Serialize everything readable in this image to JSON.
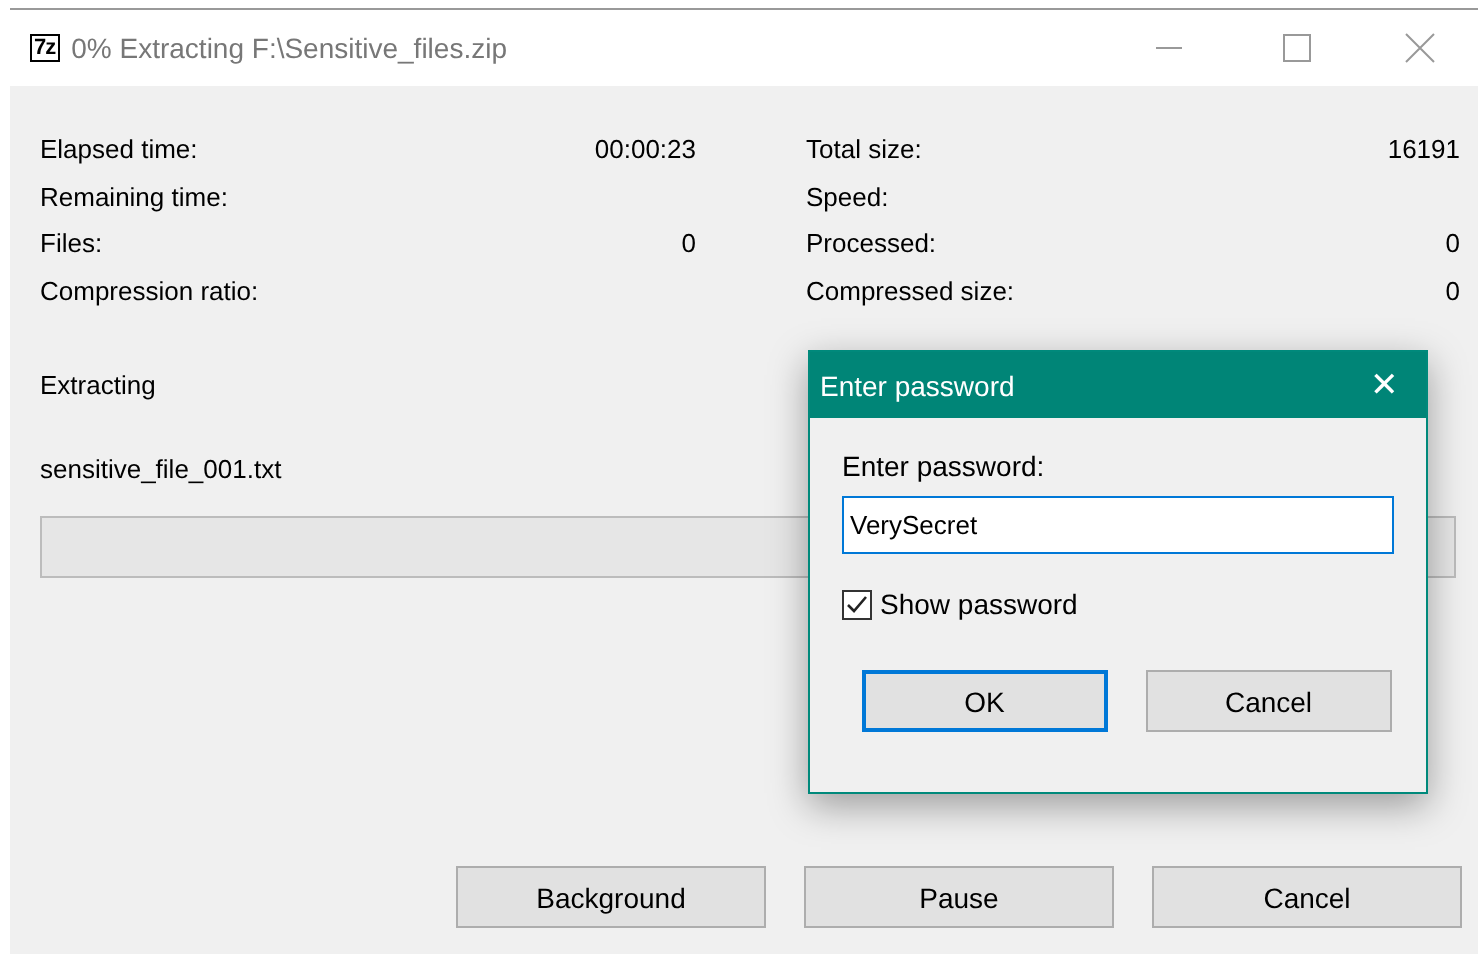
{
  "window": {
    "title": "0% Extracting F:\\Sensitive_files.zip",
    "app_icon": "7z"
  },
  "stats_left": [
    {
      "label": "Elapsed time:",
      "value": "00:00:23"
    },
    {
      "label": "Remaining time:"
    },
    {
      "label": "Files:",
      "value": "0"
    },
    {
      "label": "Compression ratio:"
    }
  ],
  "stats_right": [
    {
      "label": "Total size:",
      "value": "16191"
    },
    {
      "label": "Speed:"
    },
    {
      "label": "Processed:",
      "value": "0"
    },
    {
      "label": "Compressed size:",
      "value": "0"
    }
  ],
  "status": "Extracting",
  "current_file": "sensitive_file_001.txt",
  "progress": {
    "level": 0
  },
  "buttons": [
    "Background",
    "Pause",
    "Cancel"
  ],
  "dialog": {
    "title": "Enter password",
    "close": "✕",
    "label": "Enter password:",
    "value": "VerySecret",
    "show_password": {
      "label": "Show password",
      "checked": true
    },
    "buttons": [
      {
        "label": "OK",
        "default": true
      },
      {
        "label": "Cancel",
        "default": false
      }
    ]
  }
}
